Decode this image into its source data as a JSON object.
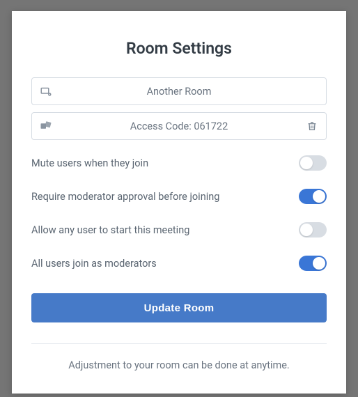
{
  "title": "Room Settings",
  "roomName": "Another Room",
  "accessCodeLabel": "Access Code: 061722",
  "settings": {
    "mute": {
      "label": "Mute users when they join",
      "on": false
    },
    "approval": {
      "label": "Require moderator approval before joining",
      "on": true
    },
    "anyoneStart": {
      "label": "Allow any user to start this meeting",
      "on": false
    },
    "joinAsMod": {
      "label": "All users join as moderators",
      "on": true
    }
  },
  "updateButton": "Update Room",
  "footer": "Adjustment to your room can be done at anytime."
}
